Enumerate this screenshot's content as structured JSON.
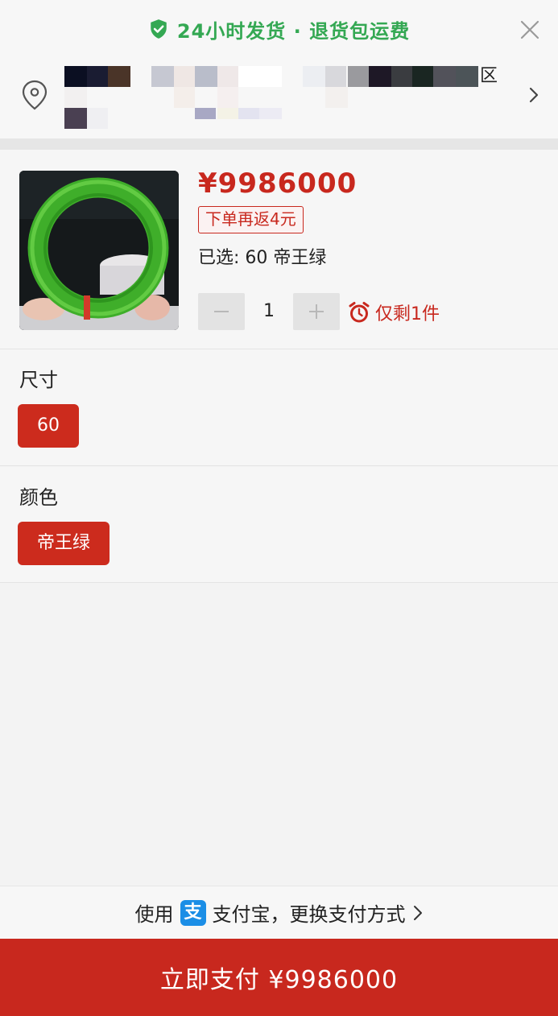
{
  "top_banner": {
    "text": "24小时发货 · 退货包运费",
    "accent": "#34a853"
  },
  "address": {
    "trailing_char": "区"
  },
  "product": {
    "price": "¥9986000",
    "rebate": "下单再返4元",
    "selected": "已选: 60 帝王绿",
    "quantity": "1",
    "stock": "仅剩1件",
    "accent": "#c8281e"
  },
  "size": {
    "title": "尺寸",
    "option": "60"
  },
  "color": {
    "title": "颜色",
    "option": "帝王绿"
  },
  "payment": {
    "prefix": "使用",
    "alipay_glyph": "支",
    "method": "支付宝，更换支付方式"
  },
  "paybar": {
    "label": "立即支付 ¥9986000"
  }
}
